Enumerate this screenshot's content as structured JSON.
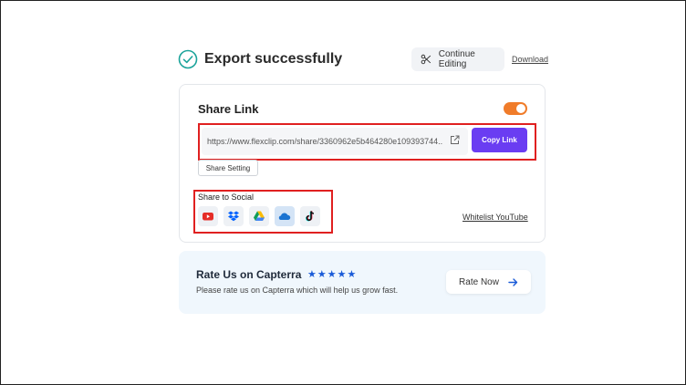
{
  "header": {
    "title": "Export successfully",
    "continue_label": "Continue Editing",
    "download_label": "Download"
  },
  "share": {
    "title": "Share Link",
    "toggle_on": true,
    "link_value": "https://www.flexclip.com/share/3360962e5b464280e109393744...",
    "copy_label": "Copy Link",
    "setting_label": "Share Setting",
    "social_label": "Share to Social",
    "social_icons": [
      "youtube-icon",
      "dropbox-icon",
      "google-drive-icon",
      "onedrive-icon",
      "tiktok-icon"
    ],
    "whitelist_label": "Whitelist YouTube"
  },
  "rate": {
    "title": "Rate Us on Capterra",
    "stars": "★★★★★",
    "description": "Please rate us on Capterra which will help us grow fast.",
    "button_label": "Rate Now"
  },
  "colors": {
    "accent_purple": "#6a3df2",
    "toggle_orange": "#f07c2a",
    "success_teal": "#1aa39a",
    "star_blue": "#1a5bd8",
    "highlight_red": "#e02020"
  }
}
